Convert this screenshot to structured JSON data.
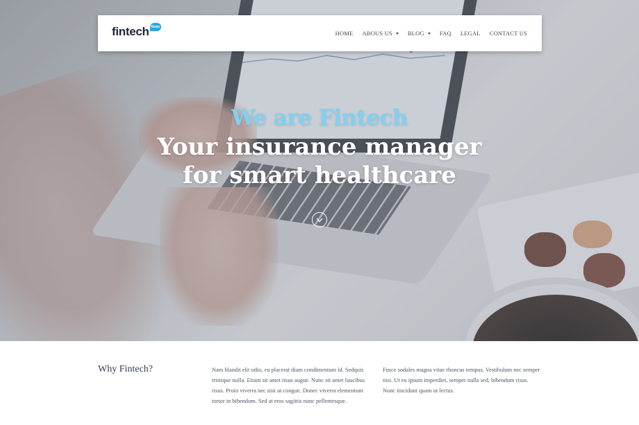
{
  "brand": {
    "name": "fintech",
    "badge": "News"
  },
  "nav": {
    "items": [
      {
        "label": "HOME",
        "dropdown": false
      },
      {
        "label": "ABOUS US",
        "dropdown": true
      },
      {
        "label": "BLOG",
        "dropdown": true
      },
      {
        "label": "FAQ",
        "dropdown": false
      },
      {
        "label": "LEGAL",
        "dropdown": false
      },
      {
        "label": "CONTACT US",
        "dropdown": false
      }
    ]
  },
  "hero": {
    "subtitle": "We are Fintech",
    "title_line1": "Your insurance manager",
    "title_line2": "for smart healthcare",
    "scroll_icon": "chevron-down-icon"
  },
  "about": {
    "heading": "Why Fintech?",
    "col1": "Nam blandit elit odio, eu placerat diam condimentum id. Sedquis tristique nulla. Etiam sit amet risus augue. Nunc sit amet faucibus risus. Proin viverra nec nisi ut congue. Donec viverra elementum tortor in bibendum. Sed at eros sagittis nunc pellentesque.",
    "col2": "Fusce sodales magna vitae rhoncus tempus. Vestibulum nec semper nisi. Ut eu ipsum imperdiet, semper nulla sed, bibendum risus. Nunc tincidunt quam ut lectus."
  },
  "colors": {
    "accent": "#7fd1f2",
    "badge": "#2aa7e0",
    "heading": "#2f3d54",
    "nav_text": "#3e4452"
  }
}
